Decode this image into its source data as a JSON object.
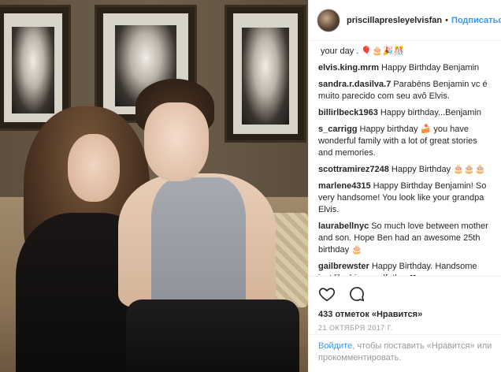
{
  "post": {
    "username": "priscillapresleyelvisfan",
    "separator": "•",
    "follow_label": "Подписаться"
  },
  "comments": [
    {
      "author": "",
      "text": "your day . 🎈🎂🎉🎊"
    },
    {
      "author": "elvis.king.mrm",
      "text": "Happy Birthday Benjamin"
    },
    {
      "author": "sandra.r.dasilva.7",
      "text": "Parabéns Benjamin vc é muito parecido com seu avô Elvis."
    },
    {
      "author": "billirlbeck1963",
      "text": "Happy birthday...Benjamin"
    },
    {
      "author": "s_carrigg",
      "text": "Happy birthday 🍰 you have wonderful family with a lot of great stories and memories."
    },
    {
      "author": "scottramirez7248",
      "text": "Happy Birthday 🎂🎂🎂"
    },
    {
      "author": "marlene4315",
      "text": "Happy Birthday Benjamin! So very handsome! You look like your grandpa Elvis."
    },
    {
      "author": "laurabellnyc",
      "text": "So much love between mother and son. Hope Ben had an awesome 25th birthday 🎂"
    },
    {
      "author": "gailbrewster",
      "text": "Happy Birthday. Handsome just like his grandfather.❤"
    }
  ],
  "actions": {
    "like_icon": "heart-outline-icon",
    "comment_icon": "speech-bubble-icon",
    "likes_text": "433 отметок «Нравится»",
    "date_text": "21 ОКТЯБРЯ 2017 Г."
  },
  "login": {
    "link_text": "Войдите",
    "rest_text": ", чтобы поставить «Нравится» или прокомментировать."
  },
  "colors": {
    "accent": "#3897f0",
    "text": "#262626",
    "muted": "#999999",
    "border": "#efefef"
  }
}
